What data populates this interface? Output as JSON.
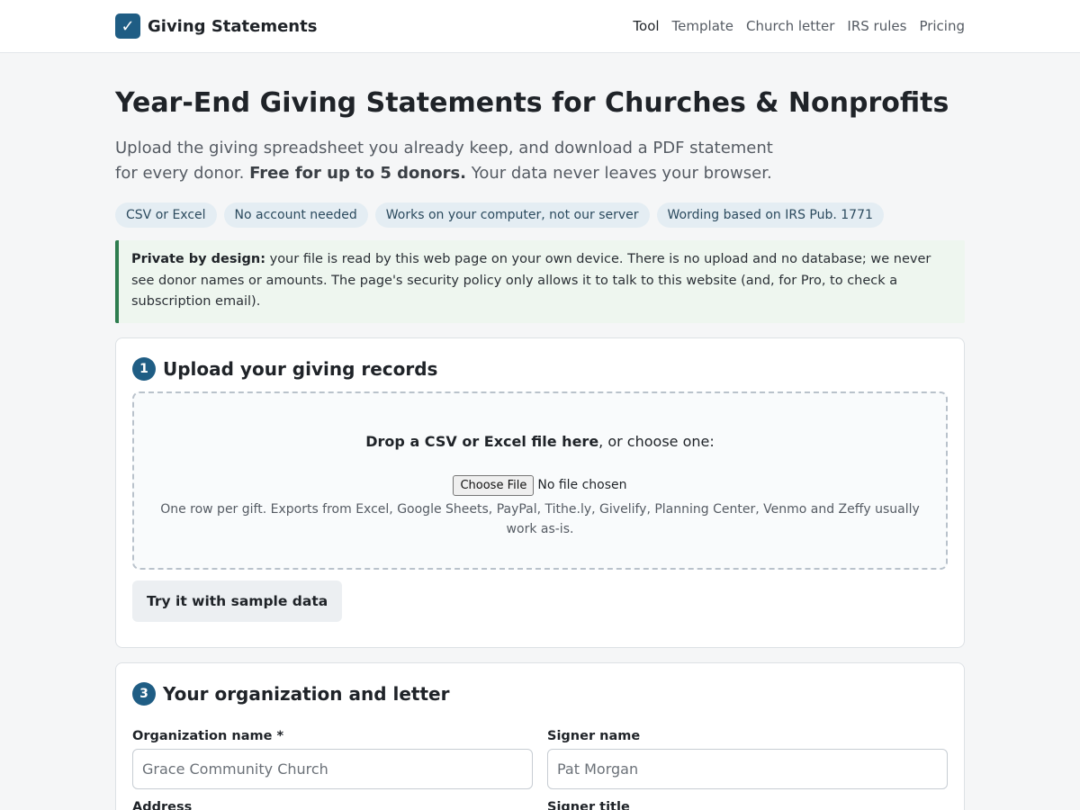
{
  "header": {
    "logo_glyph": "✓",
    "brand": "Giving Statements",
    "nav": [
      {
        "label": "Tool",
        "active": true
      },
      {
        "label": "Template",
        "active": false
      },
      {
        "label": "Church letter",
        "active": false
      },
      {
        "label": "IRS rules",
        "active": false
      },
      {
        "label": "Pricing",
        "active": false
      }
    ]
  },
  "hero": {
    "title": "Year-End Giving Statements for Churches & Nonprofits",
    "lead_part1": "Upload the giving spreadsheet you already keep, and download a PDF statement for every donor. ",
    "lead_bold": "Free for up to 5 donors.",
    "lead_part2": " Your data never leaves your browser."
  },
  "pills": [
    "CSV or Excel",
    "No account needed",
    "Works on your computer, not our server",
    "Wording based on IRS Pub. 1771"
  ],
  "notice": {
    "bold": "Private by design:",
    "text": " your file is read by this web page on your own device. There is no upload and no database; we never see donor names or amounts. The page's security policy only allows it to talk to this website (and, for Pro, to check a subscription email)."
  },
  "step1": {
    "number": "1",
    "title": "Upload your giving records",
    "drop_bold": "Drop a CSV or Excel file here",
    "drop_rest": ", or choose one:",
    "file_button": "Choose File",
    "file_status": "No file chosen",
    "help": "One row per gift. Exports from Excel, Google Sheets, PayPal, Tithe.ly, Givelify, Planning Center, Venmo and Zeffy usually work as-is.",
    "sample_button": "Try it with sample data"
  },
  "step3": {
    "number": "3",
    "title": "Your organization and letter",
    "org_label": "Organization name *",
    "org_placeholder": "Grace Community Church",
    "signer_label": "Signer name",
    "signer_placeholder": "Pat Morgan",
    "address_label": "Address",
    "signer_title_label": "Signer title"
  },
  "colors": {
    "accent": "#1f5d84",
    "notice_border": "#2e7d4f",
    "notice_bg": "#eef6ef",
    "pill_bg": "#e4edf3"
  }
}
